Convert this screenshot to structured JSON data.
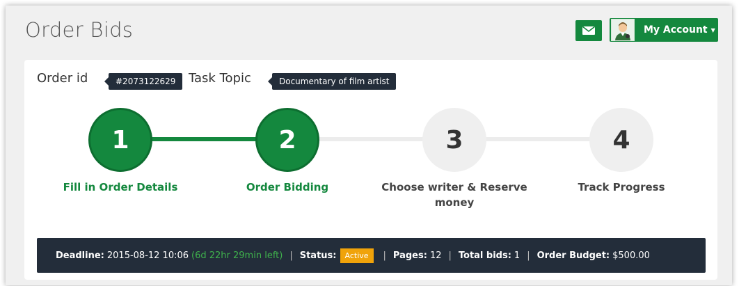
{
  "header": {
    "title": "Order Bids",
    "account_label": "My Account",
    "caret": "▼"
  },
  "order": {
    "id_label": "Order id",
    "id_value": "#2073122629",
    "topic_label": "Task Topic",
    "topic_value": "Documentary of film artist"
  },
  "steps": [
    {
      "number": "1",
      "label": "Fill in Order Details",
      "state": "completed"
    },
    {
      "number": "2",
      "label": "Order Bidding",
      "state": "active"
    },
    {
      "number": "3",
      "label": "Choose writer & Reserve money",
      "state": "pending"
    },
    {
      "number": "4",
      "label": "Track Progress",
      "state": "pending"
    }
  ],
  "info": {
    "deadline_label": "Deadline:",
    "deadline_value": "2015-08-12 10:06",
    "time_left": "(6d 22hr 29min left)",
    "status_label": "Status:",
    "status_value": "Active",
    "pages_label": "Pages:",
    "pages_value": "12",
    "bids_label": "Total bids:",
    "bids_value": "1",
    "budget_label": "Order Budget:",
    "budget_value": "$500.00",
    "separator": "|"
  },
  "colors": {
    "brand_green": "#14883e",
    "dark_navy": "#232d3a",
    "status_orange": "#f0a30a"
  }
}
